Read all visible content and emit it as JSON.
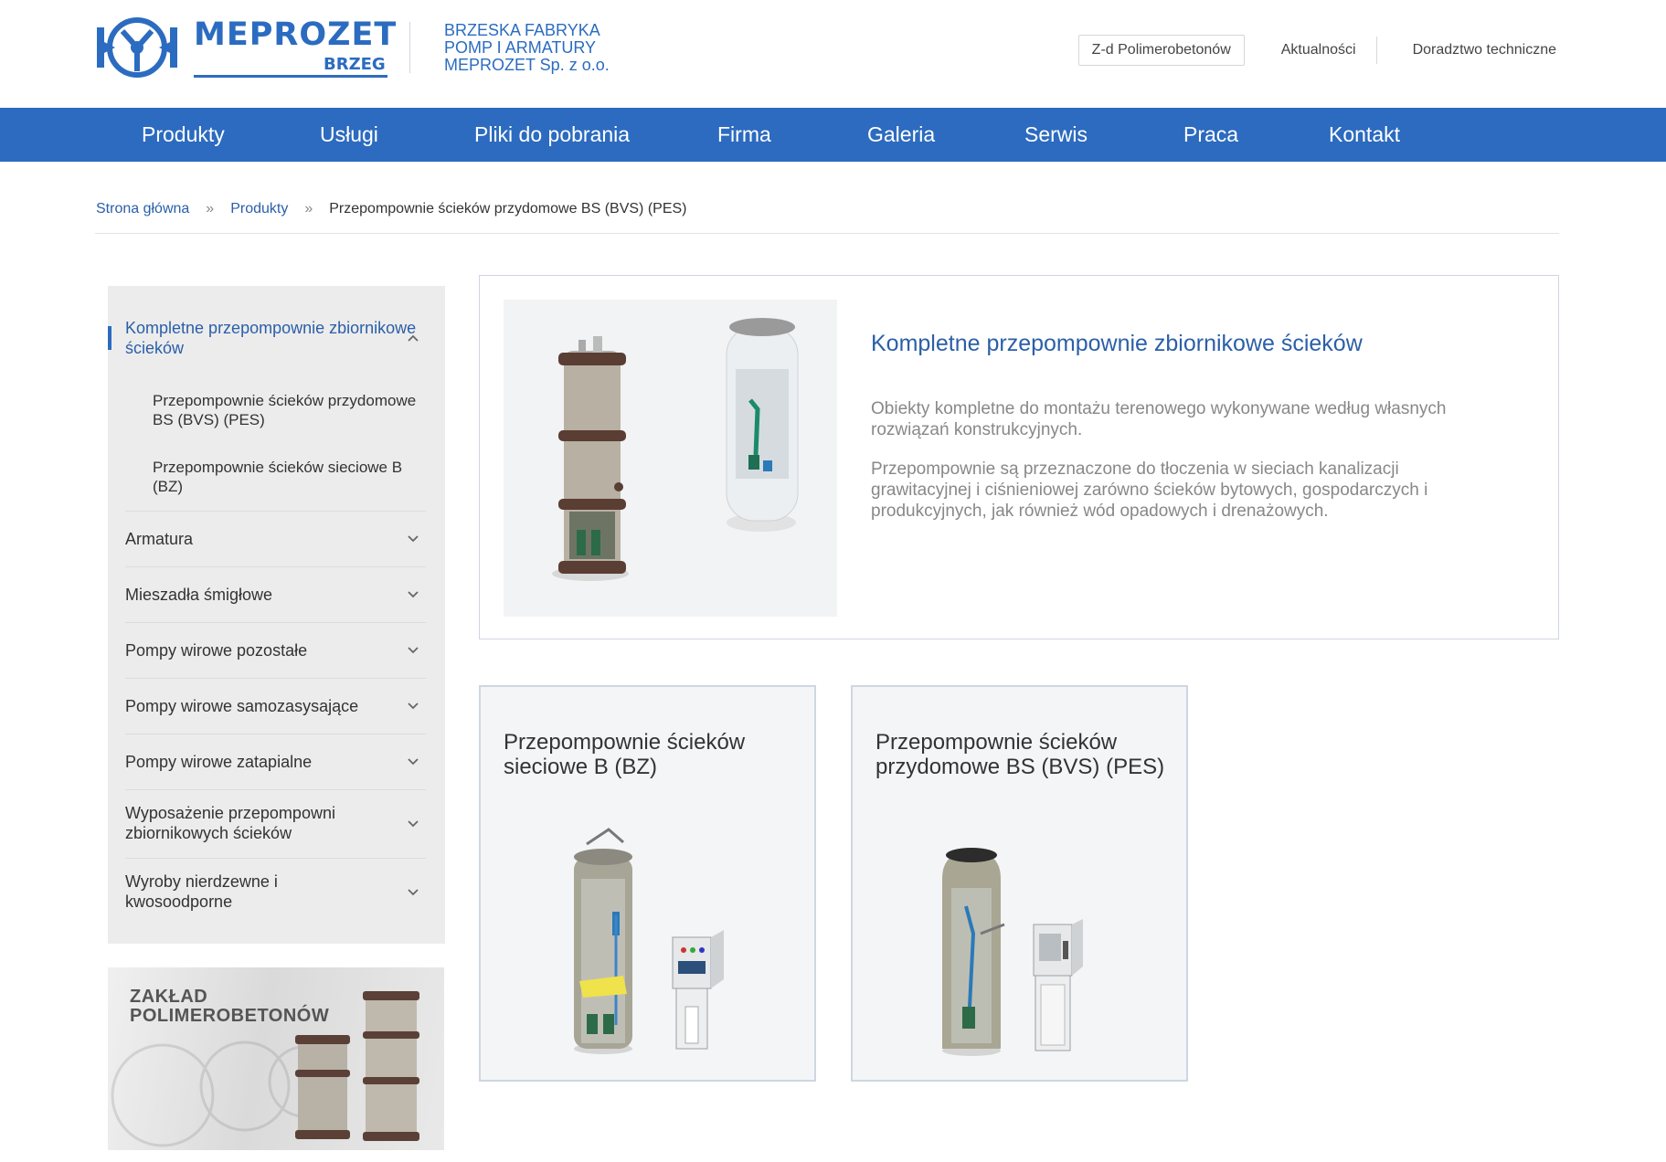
{
  "header": {
    "logo_text": "MEPROZET",
    "logo_sub": "BRZEG",
    "company_lines": [
      "BRZESKA FABRYKA",
      "POMP I ARMATURY",
      "MEPROZET Sp. z o.o."
    ],
    "top_links": [
      "Z-d Polimerobetonów",
      "Aktualności",
      "Doradztwo techniczne"
    ]
  },
  "nav": {
    "items": [
      "Produkty",
      "Usługi",
      "Pliki do pobrania",
      "Firma",
      "Galeria",
      "Serwis",
      "Praca",
      "Kontakt"
    ]
  },
  "breadcrumb": {
    "home": "Strona główna",
    "products": "Produkty",
    "current": "Przepompownie ścieków przydomowe BS (BVS) (PES)",
    "separator": "»"
  },
  "sidebar": {
    "active": "Kompletne przepompownie zbiornikowe ścieków",
    "subitems": [
      "Przepompownie ścieków przydomowe BS (BVS) (PES)",
      "Przepompownie ścieków sieciowe B (BZ)"
    ],
    "items": [
      "Armatura",
      "Mieszadła śmigłowe",
      "Pompy wirowe pozostałe",
      "Pompy wirowe samozasysające",
      "Pompy wirowe zatapialne",
      "Wyposażenie przepompowni zbiornikowych ścieków",
      "Wyroby nierdzewne i kwosoodporne"
    ]
  },
  "promo": {
    "line1": "ZAKŁAD",
    "line2": "POLIMEROBETONÓW"
  },
  "feature": {
    "title": "Kompletne przepompownie zbiornikowe ścieków",
    "p1": "Obiekty kompletne do montażu terenowego wykonywane według własnych rozwiązań konstrukcyjnych.",
    "p2": "Przepompownie są przeznaczone do tłoczenia w sieciach kanalizacji grawitacyjnej i ciśnieniowej zarówno ścieków bytowych, gospodarczych i produkcyjnych, jak również wód opadowych i drenażowych."
  },
  "cards": [
    {
      "title": "Przepompownie ścieków sieciowe B (BZ)"
    },
    {
      "title": "Przepompownie ścieków przydomowe BS (BVS) (PES)"
    }
  ],
  "colors": {
    "brand_blue": "#2c6bbf",
    "link_blue": "#2b5fa8",
    "sidebar_bg": "#ececec"
  }
}
